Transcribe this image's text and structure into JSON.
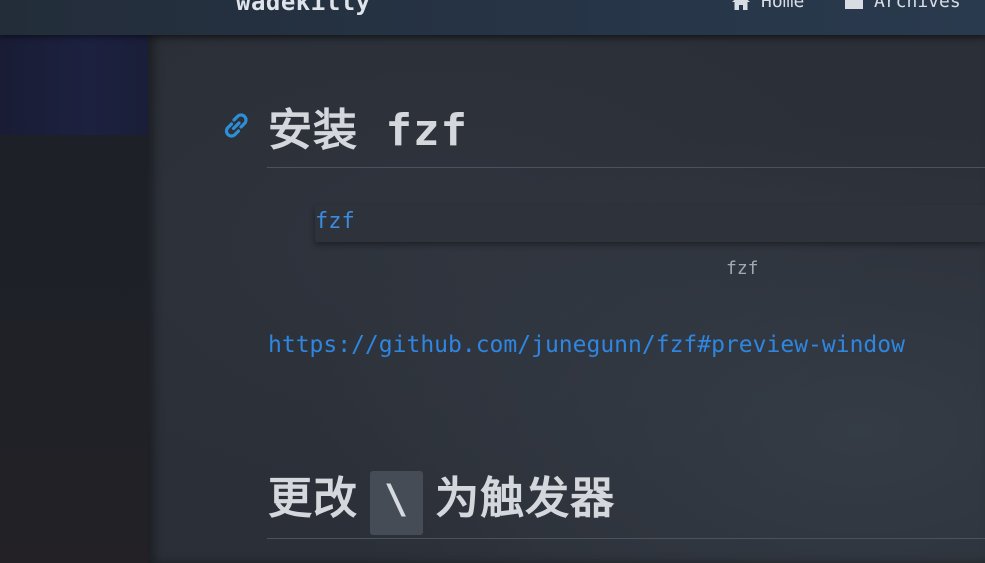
{
  "navbar": {
    "brand": "wadekilly",
    "items": [
      {
        "label": "Home",
        "icon": "home-icon"
      },
      {
        "label": "Archives",
        "icon": "folder-icon"
      }
    ]
  },
  "article": {
    "heading_install": "安装 fzf",
    "anchor_icon": "link-icon",
    "code_block": "fzf",
    "caption": "fzf",
    "link": "https://github.com/junegunn/fzf#preview-window",
    "heading_trigger_before": "更改",
    "heading_trigger_code": "\\",
    "heading_trigger_after": "为触发器"
  },
  "colors": {
    "accent": "#2e86e0",
    "background": "#2b2f37",
    "heading": "#d4d8dd"
  }
}
